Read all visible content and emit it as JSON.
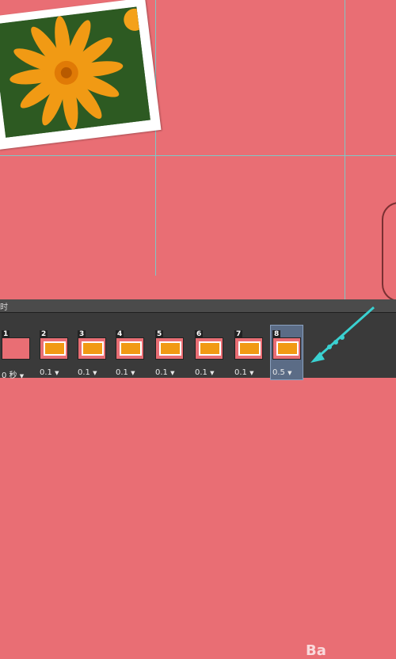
{
  "timeline": {
    "label": "时",
    "frames": [
      {
        "number": "1",
        "delay": "0 秒"
      },
      {
        "number": "2",
        "delay": "0.1"
      },
      {
        "number": "3",
        "delay": "0.1"
      },
      {
        "number": "4",
        "delay": "0.1"
      },
      {
        "number": "5",
        "delay": "0.1"
      },
      {
        "number": "6",
        "delay": "0.1"
      },
      {
        "number": "7",
        "delay": "0.1"
      },
      {
        "number": "8",
        "delay": "0.5"
      }
    ],
    "selected_frame": 8
  },
  "colors": {
    "canvas_bg": "#e96e74",
    "guide": "#7fc7c6",
    "selection": "#5b6c86"
  },
  "icons": [
    "chevron-down-icon"
  ],
  "watermark": {
    "text": "Ba"
  }
}
